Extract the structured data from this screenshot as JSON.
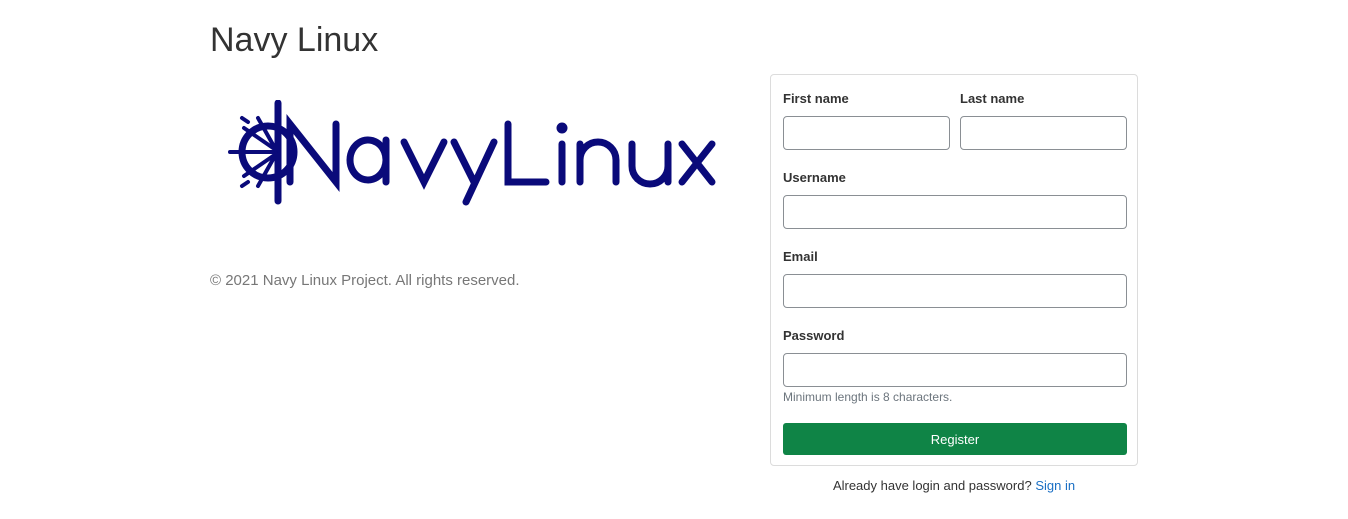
{
  "page": {
    "title": "Navy Linux",
    "copyright": "© 2021 Navy Linux Project. All rights reserved.",
    "logo_text": "NavyLinux",
    "brand_color": "#0a0a7a"
  },
  "form": {
    "first_name_label": "First name",
    "first_name_value": "",
    "last_name_label": "Last name",
    "last_name_value": "",
    "username_label": "Username",
    "username_value": "",
    "email_label": "Email",
    "email_value": "",
    "password_label": "Password",
    "password_value": "",
    "password_help": "Minimum length is 8 characters.",
    "register_label": "Register",
    "register_color": "#0f8446"
  },
  "footer": {
    "signin_prompt": "Already have login and password?",
    "signin_link": "Sign in",
    "link_color": "#1a6fc4"
  }
}
